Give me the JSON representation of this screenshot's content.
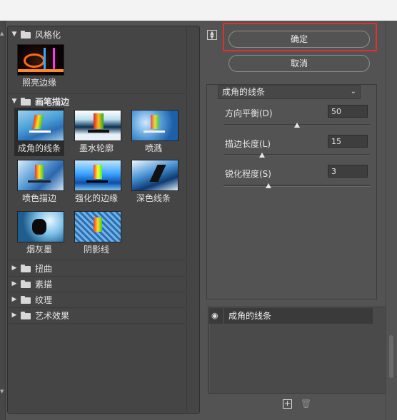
{
  "buttons": {
    "ok": "确定",
    "cancel": "取消"
  },
  "gallery": {
    "categories": [
      {
        "name": "风格化",
        "expanded": true
      },
      {
        "name": "画笔描边",
        "expanded": true
      },
      {
        "name": "扭曲",
        "expanded": false
      },
      {
        "name": "素描",
        "expanded": false
      },
      {
        "name": "纹理",
        "expanded": false
      },
      {
        "name": "艺术效果",
        "expanded": false
      }
    ],
    "stylize_filters": [
      "照亮边缘"
    ],
    "brush_filters": [
      "成角的线条",
      "墨水轮廓",
      "喷溅",
      "喷色描边",
      "强化的边缘",
      "深色线条",
      "烟灰墨",
      "阴影线"
    ],
    "selected_filter": "成角的线条"
  },
  "params": {
    "filter_select": "成角的线条",
    "direction_balance": {
      "label": "方向平衡(D)",
      "value": "50",
      "slider_fraction": 0.5
    },
    "stroke_length": {
      "label": "描边长度(L)",
      "value": "15",
      "slider_fraction": 0.3
    },
    "sharpness": {
      "label": "锐化程度(S)",
      "value": "3",
      "slider_fraction": 0.3
    }
  },
  "layers": {
    "items": [
      {
        "name": "成角的线条",
        "visible": true
      }
    ]
  },
  "icons": {
    "eye": "eye-icon",
    "new_layer": "new-effect-layer-icon",
    "delete": "trash-icon",
    "collapse": "collapse-icon"
  },
  "colors": {
    "highlight_border": "#e03030",
    "panel_bg": "#535353",
    "gallery_bg": "#454545"
  }
}
